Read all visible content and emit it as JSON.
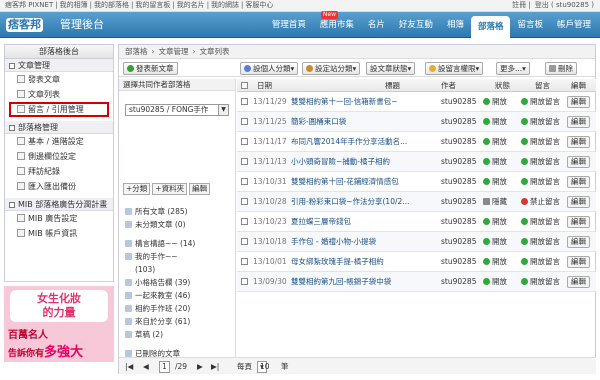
{
  "topbar": {
    "left": [
      "痞客邦 PIXNET",
      "我的相簿",
      "我的部落格",
      "我的留言板",
      "我的名片",
      "我的網誌",
      "客服中心"
    ],
    "right_user": "註冊",
    "right_hello": "登出 ( stu90285 )"
  },
  "header": {
    "logo": "痞客邦",
    "title": "管理後台",
    "tabs": [
      "管理首頁",
      "應用市集",
      "名片",
      "好友互動",
      "相簿",
      "部落格",
      "留言板",
      "帳戶管理"
    ],
    "active_tab": "部落格",
    "new_badge": "New"
  },
  "sidebar": {
    "title": "部落格後台",
    "groups": [
      {
        "label": "文章管理",
        "items": [
          "發表文章",
          "文章列表",
          "留言 / 引用管理"
        ]
      },
      {
        "label": "部落格管理",
        "items": [
          "基本 / 進階設定",
          "側邊欄位設定",
          "拜訪紀錄",
          "匯入匯出備份"
        ]
      },
      {
        "label": "MIB 部落格廣告分潤計畫",
        "items": [
          "MIB 廣告設定",
          "MIB 帳戶資訊"
        ]
      }
    ]
  },
  "ad": {
    "line1": "女生化妝",
    "line2": "的力量",
    "line3": "百萬名人",
    "line4a": "告訴你有",
    "line4b": "多強大"
  },
  "breadcrumb": [
    "部落格",
    "›",
    "文章管理",
    "›",
    "文章列表"
  ],
  "toolbar": {
    "new_post": "發表新文章",
    "set_category": "設個人分類",
    "set_site_category": "設定站分類",
    "set_status": "設文章狀態",
    "set_comment": "設留言權限",
    "more": "更多...",
    "delete": "刪除"
  },
  "left_panel": {
    "label": "選擇共同作者部落格",
    "select_value": "stu90285 / FONG手作",
    "btn_add_cat": "+分類",
    "btn_add_folder": "+資料夾",
    "btn_edit": "編輯",
    "folders": [
      "所有文章 (285)",
      "未分類文章 (0)",
      "構言構語~~ (14)",
      "我的手作~~",
      "(103)",
      "小格格告欄 (39)",
      "一起來教室 (46)",
      "相約手作班 (20)",
      "來自於分享 (61)",
      "草稿 (2)",
      "已刪除的文章"
    ]
  },
  "table": {
    "headers": {
      "date": "日期",
      "title": "標題",
      "author": "作者",
      "status": "狀態",
      "comment": "留言",
      "edit": "編輯"
    },
    "rows": [
      {
        "date": "13/11/29",
        "title": "雙雙相約第十一回-信箱新書包~",
        "author": "stu90285",
        "status": "開放",
        "comment": "開放留言",
        "edit": "編輯",
        "lock": false,
        "closed": false
      },
      {
        "date": "13/11/25",
        "title": "簡彩-圓桶束口袋",
        "author": "stu90285",
        "status": "開放",
        "comment": "開放留言",
        "edit": "編輯",
        "lock": false,
        "closed": false
      },
      {
        "date": "13/11/17",
        "title": "布同凡響2014年手作分享活動名...",
        "author": "stu90285",
        "status": "開放",
        "comment": "開放留言",
        "edit": "編輯",
        "lock": false,
        "closed": false
      },
      {
        "date": "13/11/13",
        "title": "小小頭奇冒險~捕動-橘子相約",
        "author": "stu90285",
        "status": "開放",
        "comment": "開放留言",
        "edit": "編輯",
        "lock": false,
        "closed": false
      },
      {
        "date": "13/10/31",
        "title": "雙雙相約第十回-花鋪經濟情感包",
        "author": "stu90285",
        "status": "開放",
        "comment": "開放留言",
        "edit": "編輯",
        "lock": false,
        "closed": false
      },
      {
        "date": "13/10/28",
        "title": "引用-粉彩束口袋~作法分享(10/2...",
        "author": "stu90285",
        "status": "隱藏",
        "comment": "禁止留言",
        "edit": "編輯",
        "lock": true,
        "closed": true
      },
      {
        "date": "13/10/23",
        "title": "夏拉蝶三層帝錢包",
        "author": "stu90285",
        "status": "開放",
        "comment": "開放留言",
        "edit": "編輯",
        "lock": false,
        "closed": false
      },
      {
        "date": "13/10/18",
        "title": "手作包 - 婚禮小物-小提袋",
        "author": "stu90285",
        "status": "開放",
        "comment": "開放留言",
        "edit": "編輯",
        "lock": false,
        "closed": false
      },
      {
        "date": "13/10/01",
        "title": "母女綁紮玫瑰手提-橘子相約",
        "author": "stu90285",
        "status": "開放",
        "comment": "開放留言",
        "edit": "編輯",
        "lock": false,
        "closed": false
      },
      {
        "date": "13/09/30",
        "title": "雙雙相約第九回-帳錦子袋中袋",
        "author": "stu90285",
        "status": "開放",
        "comment": "開放留言",
        "edit": "編輯",
        "lock": false,
        "closed": false
      }
    ]
  },
  "pager": {
    "page": "1",
    "total": "/29",
    "per_page_label": "每頁",
    "per_page": "10",
    "unit": "筆"
  },
  "colors": {
    "header": "#2c78b0",
    "open": "#2eaa3a",
    "closed": "#dd3333",
    "highlight": "#d40000"
  }
}
